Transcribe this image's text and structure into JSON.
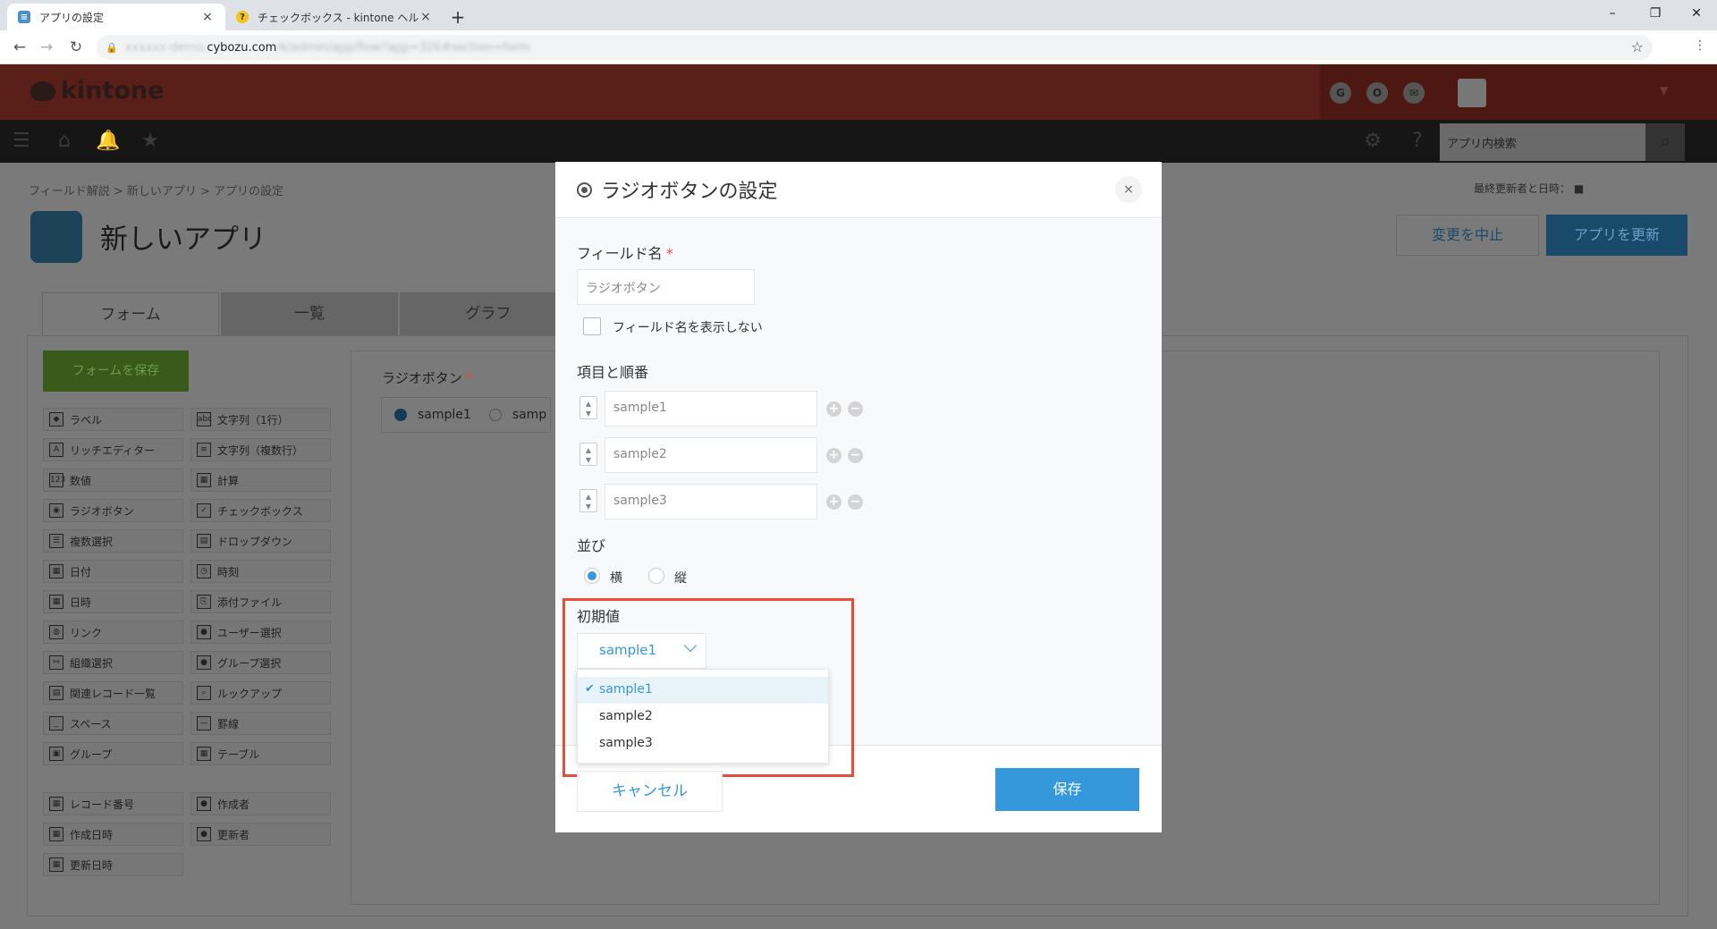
{
  "browser": {
    "tabs": [
      {
        "title": "アプリの設定",
        "close": "×"
      },
      {
        "title": "チェックボックス - kintone ヘルプ",
        "close": "×"
      }
    ],
    "new_tab": "+",
    "url_host": "cybozu.com",
    "window_controls": {
      "minimize": "–",
      "restore": "❐",
      "close": "✕"
    }
  },
  "header": {
    "logo": "kintone",
    "icons": [
      "G",
      "O",
      "✉"
    ]
  },
  "nav": {
    "search_placeholder": "アプリ内検索"
  },
  "page": {
    "breadcrumb": "フィールド解説  >  新しいアプリ  >  アプリの設定",
    "app_title": "新しいアプリ",
    "last_updated_label": "最終更新者と日時：",
    "cancel_changes": "変更を中止",
    "update_app": "アプリを更新",
    "tabs": [
      "フォーム",
      "一覧",
      "グラフ"
    ],
    "save_form": "フォームを保存",
    "palette_col1": [
      "ラベル",
      "リッチエディター",
      "数値",
      "ラジオボタン",
      "複数選択",
      "日付",
      "日時",
      "リンク",
      "組織選択",
      "関連レコード一覧",
      "スペース",
      "グループ"
    ],
    "palette_col2": [
      "文字列（1行）",
      "文字列（複数行）",
      "計算",
      "チェックボックス",
      "ドロップダウン",
      "時刻",
      "添付ファイル",
      "ユーザー選択",
      "グループ選択",
      "ルックアップ",
      "罫線",
      "テーブル"
    ],
    "palette_sys1": [
      "レコード番号",
      "作成日時",
      "更新日時"
    ],
    "palette_sys2": [
      "作成者",
      "更新者"
    ],
    "canvas_field_label": "ラジオボタン",
    "canvas_option1": "sample1",
    "canvas_option2": "samp"
  },
  "modal": {
    "title": "ラジオボタンの設定",
    "close": "×",
    "field_name_label": "フィールド名",
    "required_mark": "*",
    "field_name_value": "ラジオボタン",
    "hide_field_name_label": "フィールド名を表示しない",
    "items_label": "項目と順番",
    "items": [
      "sample1",
      "sample2",
      "sample3"
    ],
    "layout_label": "並び",
    "layout_options": [
      "横",
      "縦"
    ],
    "layout_selected": "横",
    "default_label": "初期値",
    "default_value": "sample1",
    "dropdown_options": [
      "sample1",
      "sample2",
      "sample3"
    ],
    "check_mark": "✔",
    "cancel": "キャンセル",
    "save": "保存"
  },
  "colors": {
    "accent": "#3498db",
    "highlight": "#e74c3c"
  }
}
